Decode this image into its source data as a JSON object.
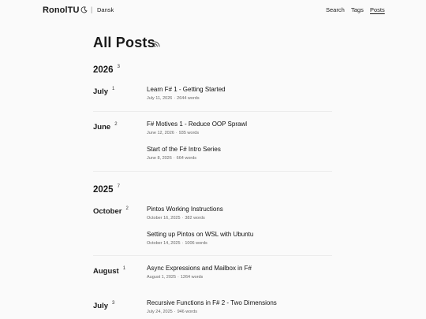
{
  "header": {
    "brand": "RonolTU",
    "separator": "|",
    "language": "Dansk",
    "theme_icon": "moon-icon",
    "nav": {
      "search": "Search",
      "tags": "Tags",
      "posts": "Posts"
    }
  },
  "page": {
    "title": "All Posts",
    "feed_icon": "rss-icon"
  },
  "sections": [
    {
      "year": "2026",
      "count": "3",
      "months": [
        {
          "name": "July",
          "count": "1",
          "posts": [
            {
              "title": "Learn F# 1 - Getting Started",
              "date": "July 11, 2026",
              "words": "2644 words"
            }
          ]
        },
        {
          "name": "June",
          "count": "2",
          "posts": [
            {
              "title": "F# Motives 1 - Reduce OOP Sprawl",
              "date": "June 12, 2026",
              "words": "935 words"
            },
            {
              "title": "Start of the F# Intro Series",
              "date": "June 8, 2026",
              "words": "664 words"
            }
          ]
        }
      ]
    },
    {
      "year": "2025",
      "count": "7",
      "months": [
        {
          "name": "October",
          "count": "2",
          "posts": [
            {
              "title": "Pintos Working Instructions",
              "date": "October 16, 2025",
              "words": "382 words"
            },
            {
              "title": "Setting up Pintos on WSL with Ubuntu",
              "date": "October 14, 2025",
              "words": "1006 words"
            }
          ]
        },
        {
          "name": "August",
          "count": "1",
          "posts": [
            {
              "title": "Async Expressions and Mailbox in F#",
              "date": "August 1, 2025",
              "words": "1264 words"
            }
          ]
        },
        {
          "name": "July",
          "count": "3",
          "posts": [
            {
              "title": "Recursive Functions in F# 2 - Two Dimensions",
              "date": "July 24, 2025",
              "words": "946 words"
            }
          ]
        }
      ]
    }
  ],
  "meta_separator": "·"
}
